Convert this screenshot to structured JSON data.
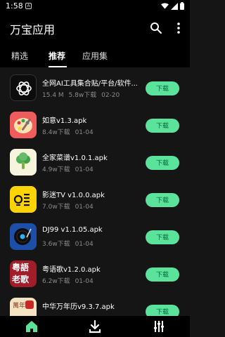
{
  "status": {
    "time": "1:58",
    "badge": "A"
  },
  "app": {
    "title": "万宝应用"
  },
  "tabs": [
    {
      "label": "精选"
    },
    {
      "label": "推荐"
    },
    {
      "label": "应用集"
    }
  ],
  "active_tab": "推荐",
  "apps": [
    {
      "name": "全网AI工具集合贴/平台/软件...",
      "size": "15.4 M",
      "downloads": "5.8w下载",
      "date": "02-20",
      "button": "下载",
      "icon": "openai-logo-icon"
    },
    {
      "name": "如意v1.3.apk",
      "size": "",
      "downloads": "8.4w下载",
      "date": "01-04",
      "button": "下载",
      "icon": "palette-icon"
    },
    {
      "name": "全家菜谱v1.0.1.apk",
      "size": "",
      "downloads": "4.9w下载",
      "date": "01-04",
      "button": "下载",
      "icon": "broccoli-icon"
    },
    {
      "name": "影迷TV v1.0.0.apk",
      "size": "",
      "downloads": "7.0w下载",
      "date": "01-04",
      "button": "下载",
      "icon": "tv-icon"
    },
    {
      "name": "DJ99 v1.1.05.apk",
      "size": "",
      "downloads": "3.6w下载",
      "date": "01-04",
      "button": "下载",
      "icon": "vinyl-record-icon"
    },
    {
      "name": "粤语歌v1.2.0.apk",
      "size": "",
      "downloads": "6.2w下载",
      "date": "01-04",
      "button": "下载",
      "icon": "cantonese-song-icon"
    },
    {
      "name": "中华万年历v9.3.7.apk",
      "size": "",
      "downloads": "",
      "date": "",
      "button": "下载",
      "icon": "calendar-icon"
    }
  ],
  "icon_text": {
    "cantonese_top": "粤語",
    "cantonese_bottom": "老歌",
    "calendar": "萬年"
  },
  "colors": {
    "accent": "#5ce39b",
    "background": "#151515",
    "bar": "#000000"
  }
}
